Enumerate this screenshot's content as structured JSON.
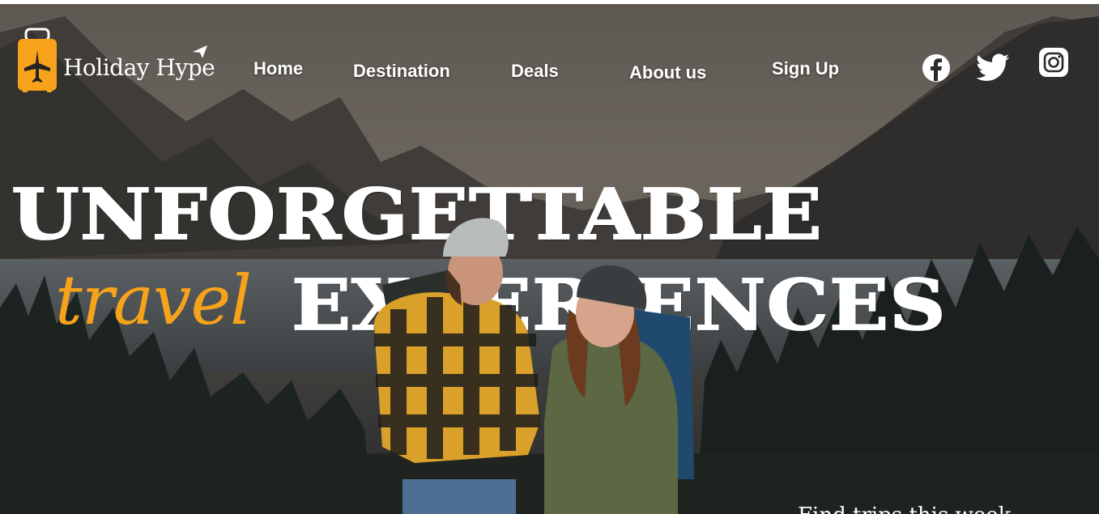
{
  "brand": {
    "name": "Holiday Hype",
    "accent_color": "#f7a21b",
    "logo_icon": "suitcase-airplane-icon"
  },
  "nav": {
    "items": [
      {
        "id": "home",
        "label": "Home"
      },
      {
        "id": "destination",
        "label": "Destination"
      },
      {
        "id": "deals",
        "label": "Deals"
      },
      {
        "id": "about",
        "label": "About us"
      },
      {
        "id": "signup",
        "label": "Sign Up"
      }
    ]
  },
  "social": [
    {
      "name": "facebook-icon"
    },
    {
      "name": "twitter-icon"
    },
    {
      "name": "instagram-icon"
    }
  ],
  "hero": {
    "headline_line1": "UNFORGETTABLE",
    "script_word": "travel",
    "headline_line2": "EXPERIENCES",
    "tagline_partial": "Find trips this week",
    "background_scene": "mountain-lake-forest-photo",
    "subject": "two-hikers-photo"
  }
}
